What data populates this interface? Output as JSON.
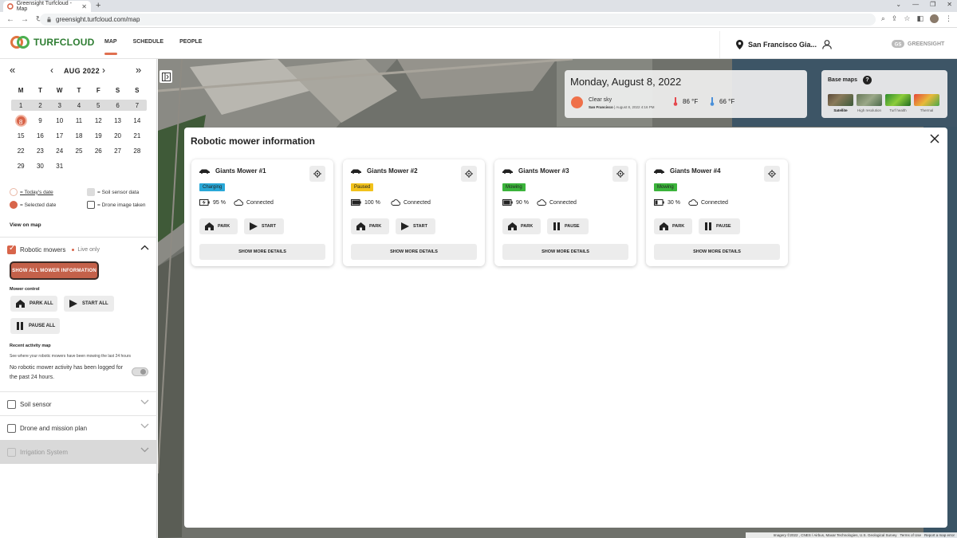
{
  "browser": {
    "tab_title": "Greensight Turfcloud - Map",
    "url": "greensight.turfcloud.com/map"
  },
  "header": {
    "brand": "TURFCLOUD",
    "nav": [
      {
        "label": "MAP",
        "active": true
      },
      {
        "label": "SCHEDULE",
        "active": false
      },
      {
        "label": "PEOPLE",
        "active": false
      }
    ],
    "location": "San Francisco Gia...",
    "partner_brand": "GREENSIGHT"
  },
  "calendar": {
    "month_label": "AUG 2022",
    "days_of_week": [
      "M",
      "T",
      "W",
      "T",
      "F",
      "S",
      "S"
    ],
    "weeks": [
      [
        "1",
        "2",
        "3",
        "4",
        "5",
        "6",
        "7"
      ],
      [
        "8",
        "9",
        "10",
        "11",
        "12",
        "13",
        "14"
      ],
      [
        "15",
        "16",
        "17",
        "18",
        "19",
        "20",
        "21"
      ],
      [
        "22",
        "23",
        "24",
        "25",
        "26",
        "27",
        "28"
      ],
      [
        "29",
        "30",
        "31",
        "",
        "",
        "",
        ""
      ]
    ],
    "selected_day": "8"
  },
  "legend": {
    "today": "= Today's date",
    "selected": "= Selected date",
    "soil": "= Soil sensor data",
    "drone": "= Drone image taken",
    "view_on_map": "View on map"
  },
  "robotic_mowers": {
    "label": "Robotic mowers",
    "live_label": "Live only",
    "show_all_button": "SHOW ALL MOWER INFORMATION",
    "mower_control_title": "Mower control",
    "park_all": "PARK ALL",
    "start_all": "START ALL",
    "pause_all": "PAUSE ALL",
    "recent_title": "Recent activity map",
    "recent_note": "See where your robotic mowers have been mowing the last 24 hours",
    "recent_text": "No robotic mower activity has been logged for the past 24 hours."
  },
  "sections": {
    "soil": "Soil sensor",
    "drone": "Drone and mission plan",
    "irrigation": "Irrigation System"
  },
  "weather": {
    "date": "Monday, August 8, 2022",
    "condition": "Clear sky",
    "place": "San Francisco",
    "timestamp": "| August 8, 2022 4:16 PM",
    "high": "86 °F",
    "low": "66 °F"
  },
  "basemaps": {
    "title": "Base maps",
    "options": [
      "Satellite",
      "High resolution",
      "Turf health",
      "Thermal"
    ],
    "selected": "Satellite"
  },
  "modal": {
    "title": "Robotic mower information",
    "connected_label": "Connected",
    "park_label": "PARK",
    "details_label": "SHOW MORE DETAILS",
    "mowers": [
      {
        "name": "Giants Mower #1",
        "status": "Charging",
        "status_color": "#29a8d8",
        "battery": "95 %",
        "action": "START"
      },
      {
        "name": "Giants Mower #2",
        "status": "Paused",
        "status_color": "#f2c21b",
        "battery": "100 %",
        "action": "START"
      },
      {
        "name": "Giants Mower #3",
        "status": "Mowing",
        "status_color": "#3cb43c",
        "battery": "90 %",
        "action": "PAUSE"
      },
      {
        "name": "Giants Mower #4",
        "status": "Mowing",
        "status_color": "#3cb43c",
        "battery": "30 %",
        "action": "PAUSE"
      }
    ]
  },
  "attribution": {
    "imagery": "Imagery ©2022 , CNES / Airbus, Maxar Technologies, U.S. Geological Survey",
    "terms": "Terms of Use",
    "report": "Report a map error"
  },
  "colors": {
    "accent": "#d8654a",
    "brand_green": "#2e7d32"
  }
}
